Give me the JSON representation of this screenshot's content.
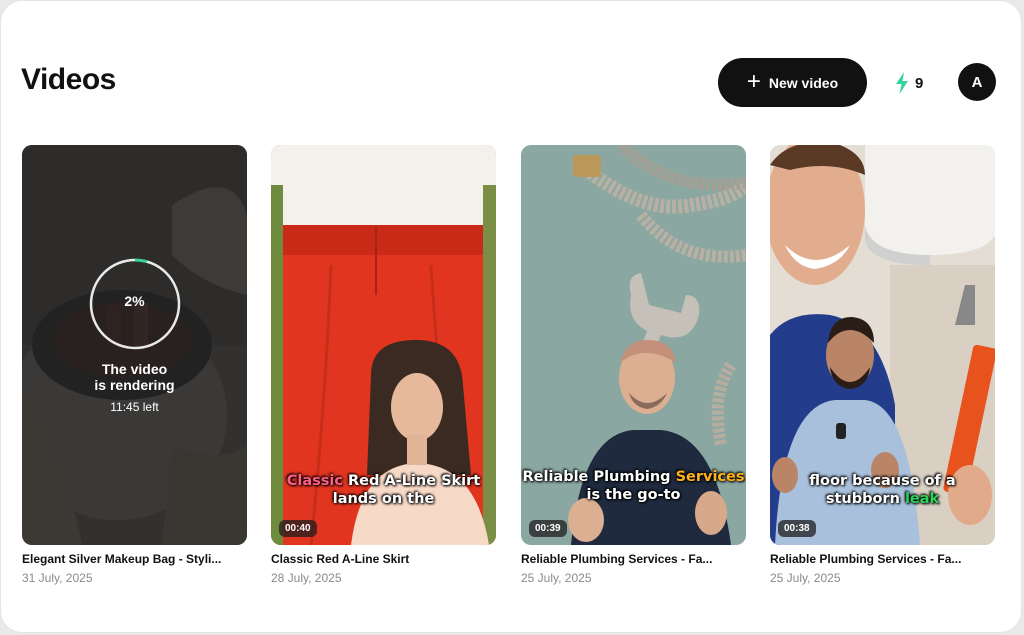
{
  "header": {
    "title": "Videos",
    "new_video_label": "New video",
    "credits": "9",
    "avatar_initial": "A",
    "accent_color": "#34d399"
  },
  "videos": [
    {
      "title": "Elegant Silver Makeup Bag - Styli...",
      "date": "31 July, 2025",
      "status": "rendering",
      "progress_label": "2%",
      "progress": 0.02,
      "render_message_line1": "The video",
      "render_message_line2": "is rendering",
      "time_left": "11:45 left"
    },
    {
      "title": "Classic Red A-Line Skirt",
      "date": "28 July, 2025",
      "duration": "00:40",
      "caption_line1_highlight": "Classic",
      "caption_line1_rest": " Red A-Line Skirt",
      "caption_line2": "lands on the"
    },
    {
      "title": "Reliable Plumbing Services - Fa...",
      "date": "25 July, 2025",
      "duration": "00:39",
      "caption_line1_start": "Reliable Plumbing ",
      "caption_line1_highlight": "Services",
      "caption_line2": "is the go-to"
    },
    {
      "title": "Reliable Plumbing Services - Fa...",
      "date": "25 July, 2025",
      "duration": "00:38",
      "caption_line1": "floor because of a",
      "caption_line2_start": "stubborn ",
      "caption_line2_highlight": "leak"
    }
  ]
}
